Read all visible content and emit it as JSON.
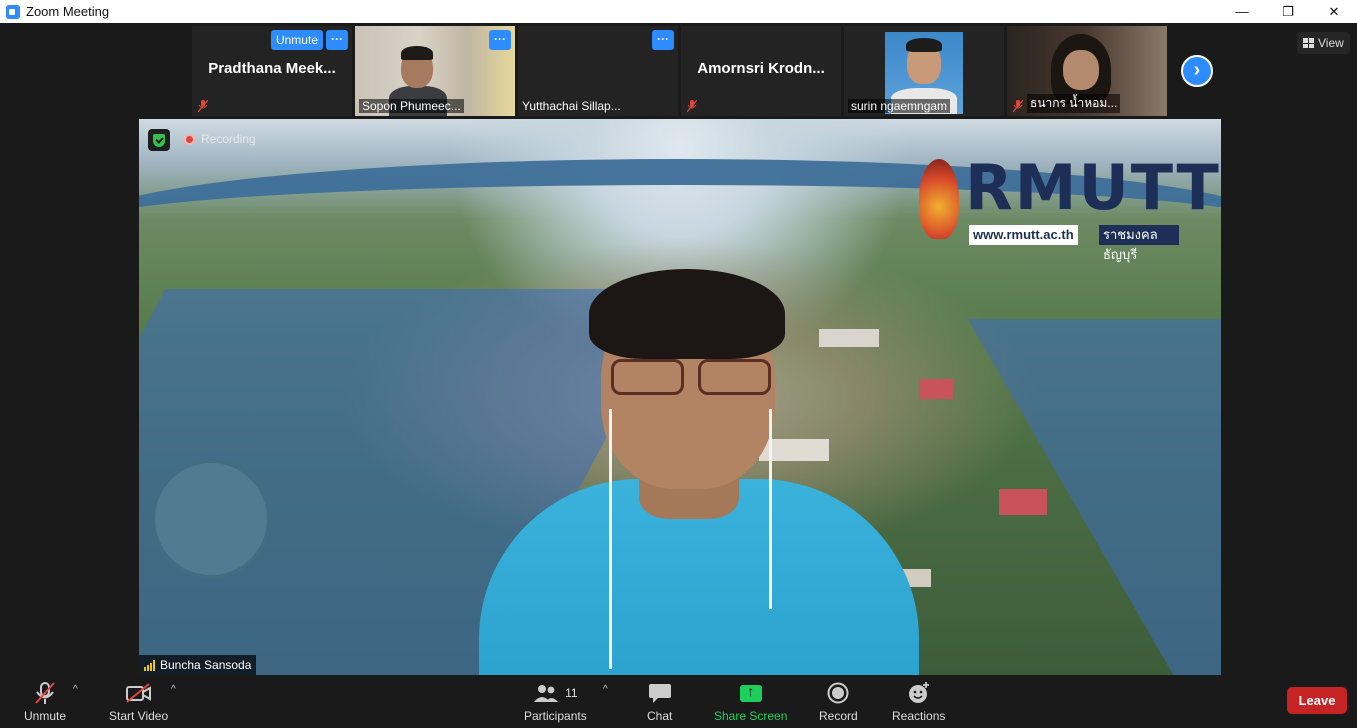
{
  "window": {
    "title": "Zoom Meeting",
    "controls": [
      "—",
      "❐",
      "✕"
    ]
  },
  "thumbnails": [
    {
      "name": "Pradthana  Meek...",
      "label": "",
      "unmute": "Unmute",
      "more": "···",
      "muted": true,
      "type": "name"
    },
    {
      "name": "",
      "label": "Sopon Phumeec...",
      "more": "···",
      "muted": false,
      "type": "office"
    },
    {
      "name": "",
      "label": "Yutthachai Sillap...",
      "more": "···",
      "muted": false,
      "type": "blank"
    },
    {
      "name": "Amornsri  Krodn...",
      "label": "",
      "muted": true,
      "type": "name"
    },
    {
      "name": "",
      "label": "surin ngaemngam",
      "muted": false,
      "type": "id"
    },
    {
      "name": "",
      "label": "ธนากร น้ำหอม...",
      "muted": true,
      "type": "dark"
    }
  ],
  "view_button": "View",
  "main_video": {
    "recording": "Recording",
    "logo_word": "RMUTT",
    "logo_url": "www.rmutt.ac.th",
    "logo_thai": "ราชมงคลธัญบุรี",
    "speaker": "Buncha Sansoda"
  },
  "toolbar": {
    "unmute": "Unmute",
    "start_video": "Start Video",
    "participants": "Participants",
    "participants_count": "11",
    "chat": "Chat",
    "share_screen": "Share Screen",
    "record": "Record",
    "reactions": "Reactions",
    "leave": "Leave"
  },
  "colors": {
    "accent": "#2d8cff",
    "share_green": "#1fcf5c",
    "leave_red": "#c62424",
    "shirt_blue": "#2aa0cc"
  }
}
